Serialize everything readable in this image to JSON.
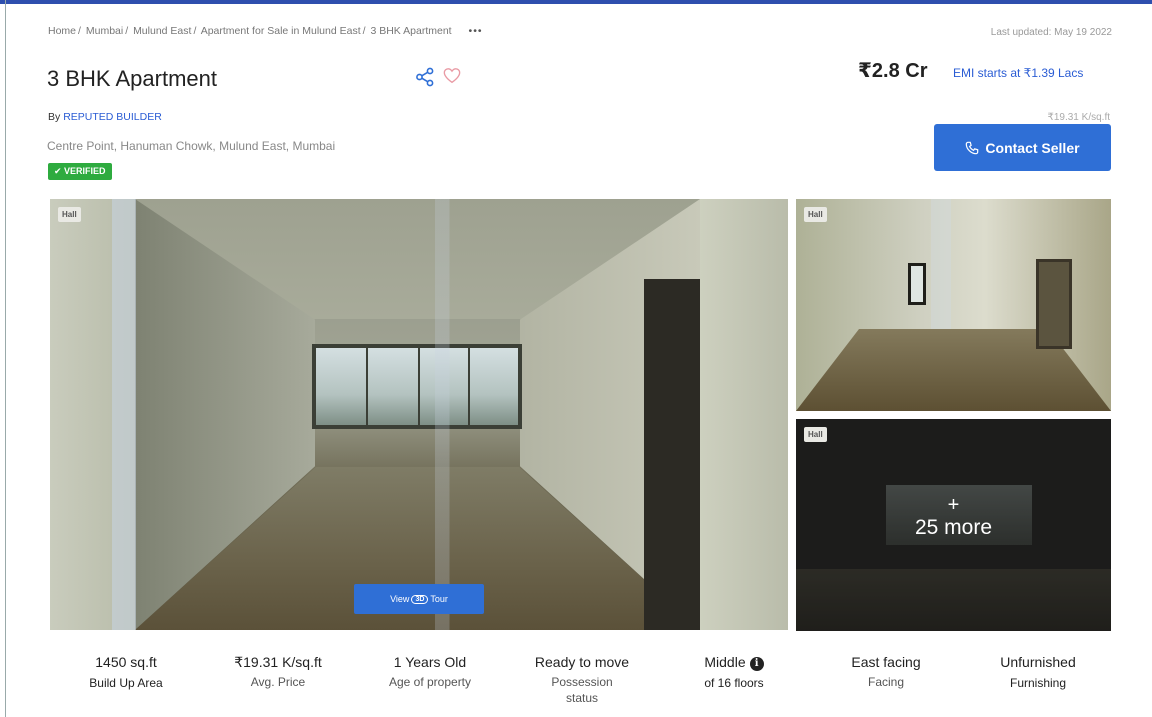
{
  "breadcrumb": {
    "items": [
      "Home",
      "Mumbai",
      "Mulund East",
      "Apartment for Sale in Mulund East",
      "3 BHK Apartment"
    ],
    "more": "•••"
  },
  "last_updated": "Last updated: May 19 2022",
  "listing": {
    "title": "3 BHK Apartment",
    "by_prefix": "By",
    "builder": "REPUTED BUILDER",
    "address": "Centre Point, Hanuman Chowk, Mulund East, Mumbai",
    "verified": "✔ VERIFIED"
  },
  "pricing": {
    "price": "₹2.8 Cr",
    "emi": "EMI starts at ₹1.39 Lacs",
    "per_sqft": "₹19.31 K/sq.ft"
  },
  "actions": {
    "contact": "Contact Seller",
    "tour_prefix": "View",
    "tour_badge": "3D",
    "tour_suffix": "Tour"
  },
  "gallery": {
    "main_tag": "Hall",
    "side1_tag": "Hall",
    "side2_tag": "Hall",
    "more_plus": "+",
    "more_label": "25 more"
  },
  "stats": [
    {
      "value": "1450 sq.ft",
      "label": "Build Up Area"
    },
    {
      "value": "₹19.31 K/sq.ft",
      "label": "Avg. Price"
    },
    {
      "value": "1 Years Old",
      "label": "Age of property"
    },
    {
      "value": "Ready to move",
      "label": "Possession status"
    },
    {
      "value": "Middle",
      "label": "of 16 floors"
    },
    {
      "value": "East facing",
      "label": "Facing"
    },
    {
      "value": "Unfurnished",
      "label": "Furnishing"
    }
  ],
  "colors": {
    "accent": "#2f6fd6",
    "verified": "#2eab3f",
    "link": "#2a5cd4"
  },
  "icons": [
    "share-icon",
    "heart-icon",
    "phone-icon",
    "info-icon"
  ]
}
